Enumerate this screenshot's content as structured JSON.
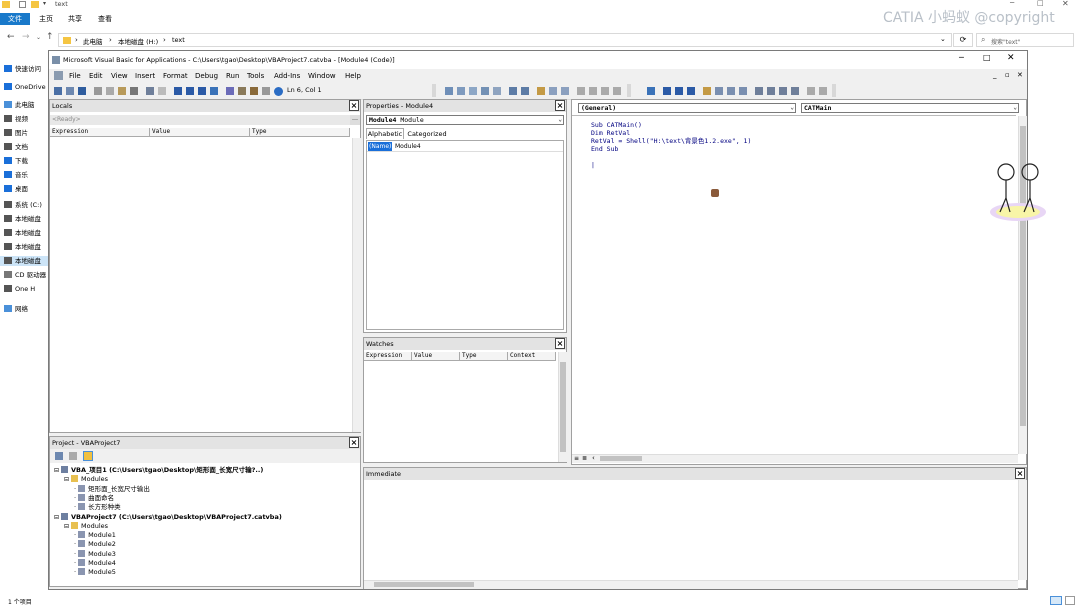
{
  "explorer": {
    "title": "text",
    "ribbon_tabs": [
      "文件",
      "主页",
      "共享",
      "查看"
    ],
    "address": {
      "parts": [
        "此电脑",
        "本地磁盘 (H:)",
        "text"
      ]
    },
    "search_placeholder": "搜索\"text\"",
    "nav": [
      {
        "label": "快速访问",
        "icon": "pin-icon"
      },
      {
        "label": "OneDrive",
        "icon": "cloud-icon"
      },
      {
        "label": "此电脑",
        "icon": "computer-icon"
      },
      {
        "label": "视频",
        "icon": "video-icon"
      },
      {
        "label": "图片",
        "icon": "image-icon"
      },
      {
        "label": "文档",
        "icon": "document-icon"
      },
      {
        "label": "下载",
        "icon": "download-icon"
      },
      {
        "label": "音乐",
        "icon": "music-icon"
      },
      {
        "label": "桌面",
        "icon": "desktop-icon"
      },
      {
        "label": "系统 (C:)",
        "icon": "drive-icon"
      },
      {
        "label": "本地磁盘",
        "icon": "drive-icon"
      },
      {
        "label": "本地磁盘",
        "icon": "drive-icon"
      },
      {
        "label": "本地磁盘",
        "icon": "drive-icon"
      },
      {
        "label": "本地磁盘",
        "icon": "drive-icon"
      },
      {
        "label": "CD 驱动器",
        "icon": "cd-icon"
      },
      {
        "label": "One H",
        "icon": "drive-icon"
      },
      {
        "label": "网络",
        "icon": "network-icon"
      }
    ],
    "status": "1 个项目",
    "watermark": "CATIA 小蚂蚁 @copyright"
  },
  "vbe": {
    "title": "Microsoft Visual Basic for Applications - C:\\Users\\tgao\\Desktop\\VBAProject7.catvba - [Module4 (Code)]",
    "menu": [
      "File",
      "Edit",
      "View",
      "Insert",
      "Format",
      "Debug",
      "Run",
      "Tools",
      "Add-Ins",
      "Window",
      "Help"
    ],
    "cursor_pos": "Ln 6, Col 1",
    "locals": {
      "title": "Locals",
      "status": "<Ready>",
      "columns": [
        "Expression",
        "Value",
        "Type"
      ]
    },
    "properties": {
      "title": "Properties - Module4",
      "object_name": "Module4",
      "object_type": "Module",
      "tabs": [
        "Alphabetic",
        "Categorized"
      ],
      "row": {
        "name": "(Name)",
        "value": "Module4"
      }
    },
    "watches": {
      "title": "Watches",
      "columns": [
        "Expression",
        "Value",
        "Type",
        "Context"
      ]
    },
    "project": {
      "title": "Project - VBAProject7",
      "tree": [
        {
          "level": 0,
          "label": "VBA_项目1 (C:\\Users\\tgao\\Desktop\\矩形面_长宽尺寸输?..)",
          "bold": true,
          "icon": "project-icon"
        },
        {
          "level": 1,
          "label": "Modules",
          "bold": false,
          "icon": "folder-icon"
        },
        {
          "level": 2,
          "label": "矩形面_长宽尺寸输出",
          "bold": false,
          "icon": "module-icon"
        },
        {
          "level": 2,
          "label": "曲面命名",
          "bold": false,
          "icon": "module-icon"
        },
        {
          "level": 2,
          "label": "长方形种类",
          "bold": false,
          "icon": "module-icon"
        },
        {
          "level": 0,
          "label": "VBAProject7 (C:\\Users\\tgao\\Desktop\\VBAProject7.catvba)",
          "bold": true,
          "icon": "project-icon"
        },
        {
          "level": 1,
          "label": "Modules",
          "bold": false,
          "icon": "folder-icon"
        },
        {
          "level": 2,
          "label": "Module1",
          "bold": false,
          "icon": "module-icon"
        },
        {
          "level": 2,
          "label": "Module2",
          "bold": false,
          "icon": "module-icon"
        },
        {
          "level": 2,
          "label": "Module3",
          "bold": false,
          "icon": "module-icon"
        },
        {
          "level": 2,
          "label": "Module4",
          "bold": false,
          "icon": "module-icon"
        },
        {
          "level": 2,
          "label": "Module5",
          "bold": false,
          "icon": "module-icon"
        }
      ]
    },
    "code": {
      "object_combo": "(General)",
      "proc_combo": "CATMain",
      "lines": [
        "Sub CATMain()",
        "Dim RetVal",
        "RetVal = Shell(\"H:\\text\\背景色1.2.exe\", 1)",
        "End Sub",
        "",
        "|"
      ]
    },
    "immediate": {
      "title": "Immediate"
    }
  }
}
